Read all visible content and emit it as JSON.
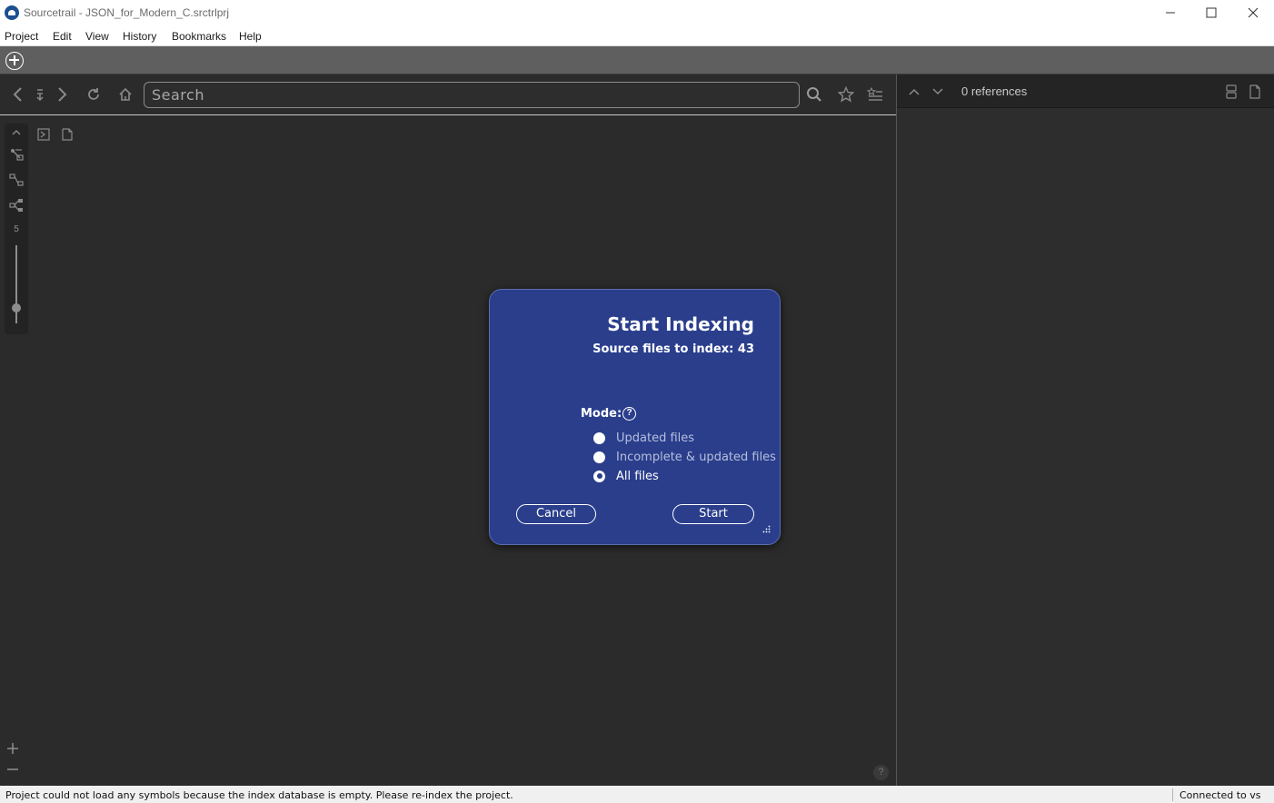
{
  "window": {
    "title": "Sourcetrail - JSON_for_Modern_C.srctrlprj"
  },
  "menu": {
    "items": [
      "Project",
      "Edit",
      "View",
      "History",
      "Bookmarks",
      "Help"
    ]
  },
  "search": {
    "placeholder": "Search"
  },
  "graph": {
    "depth_value": "5",
    "help_label": "?"
  },
  "references": {
    "count_label": "0 references"
  },
  "dialog": {
    "title": "Start Indexing",
    "subtitle": "Source files to index: 43",
    "mode_label": "Mode:",
    "mode_help": "?",
    "options": [
      {
        "label": "Updated files",
        "checked": false
      },
      {
        "label": "Incomplete & updated files",
        "checked": false
      },
      {
        "label": "All files",
        "checked": true
      }
    ],
    "cancel_label": "Cancel",
    "start_label": "Start"
  },
  "status": {
    "message": "Project could not load any symbols because the index database is empty. Please re-index the project.",
    "connection": "Connected to vs"
  },
  "colors": {
    "dialog_background": "#2a3e8c",
    "graph_background": "#2b2b2b",
    "tab_strip": "#5f5f5f"
  }
}
